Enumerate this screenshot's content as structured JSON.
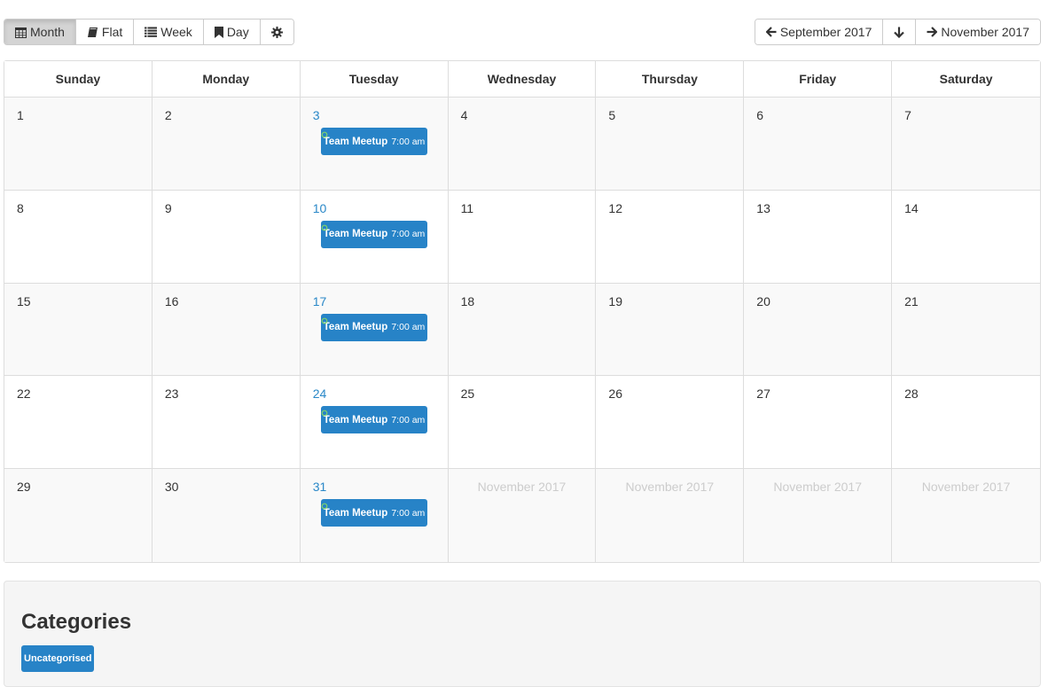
{
  "views": [
    {
      "label": "Month",
      "icon": "calendar-icon",
      "active": true
    },
    {
      "label": "Flat",
      "icon": "book-icon"
    },
    {
      "label": "Week",
      "icon": "list-icon"
    },
    {
      "label": "Day",
      "icon": "bookmark-icon"
    },
    {
      "label": "",
      "icon": "gear-icon"
    }
  ],
  "nav": {
    "prev_label": "September 2017",
    "next_label": "November 2017"
  },
  "weekdays": [
    "Sunday",
    "Monday",
    "Tuesday",
    "Wednesday",
    "Thursday",
    "Friday",
    "Saturday"
  ],
  "weeks": [
    [
      "1",
      "2",
      "3",
      "4",
      "5",
      "6",
      "7"
    ],
    [
      "8",
      "9",
      "10",
      "11",
      "12",
      "13",
      "14"
    ],
    [
      "15",
      "16",
      "17",
      "18",
      "19",
      "20",
      "21"
    ],
    [
      "22",
      "23",
      "24",
      "25",
      "26",
      "27",
      "28"
    ],
    [
      "29",
      "30",
      "31",
      "November 2017",
      "November 2017",
      "November 2017",
      "November 2017"
    ]
  ],
  "event": {
    "title": "Team Meetup",
    "time": "7:00 am",
    "color": "#2783c7"
  },
  "categories": {
    "heading": "Categories",
    "items": [
      {
        "label": "Uncategorised",
        "color": "#2783c7"
      }
    ]
  }
}
